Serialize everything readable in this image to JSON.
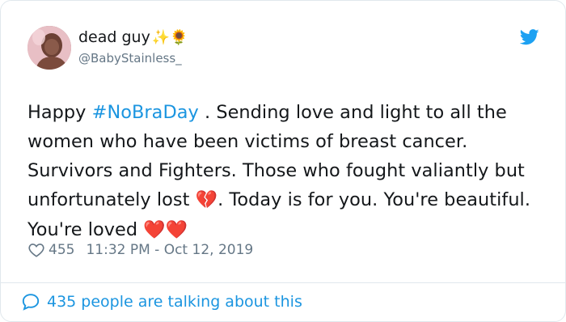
{
  "tweet": {
    "author_name": "dead guy",
    "author_emojis": "✨🌻",
    "handle": "@BabyStainless_",
    "text_before_hashtag": "Happy ",
    "hashtag": "#NoBraDay",
    "text_after_hashtag": " . Sending love and light to all the women who have been victims of breast cancer. Survivors and Fighters. Those who fought valiantly but unfortunately lost ",
    "broken_heart": "💔",
    "text_after_broken_heart": ". Today is for you. You're beautiful. You're loved ",
    "hearts": "❤️❤️",
    "like_count": "455",
    "timestamp": "11:32 PM - Oct 12, 2019",
    "talking_about": "435 people are talking about this"
  },
  "colors": {
    "link": "#1b95e0",
    "secondary_text": "#657786",
    "border": "#e1e8ed"
  },
  "icons": {
    "brand": "twitter-bird-icon",
    "like": "heart-outline-icon",
    "reply": "speech-bubble-icon"
  }
}
